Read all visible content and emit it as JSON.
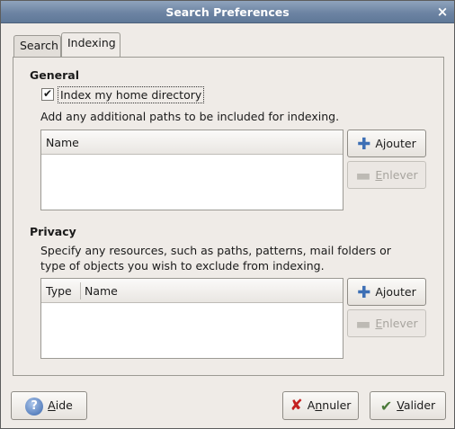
{
  "window": {
    "title": "Search Preferences",
    "close_label": "×"
  },
  "tabs": [
    {
      "label": "Search",
      "active": false
    },
    {
      "label": "Indexing",
      "active": true
    }
  ],
  "general": {
    "title": "General",
    "index_home_label": "Index my home directory",
    "index_home_checked": true,
    "paths_description": "Add any additional paths to be included for indexing.",
    "paths_list": {
      "columns": [
        "Name"
      ],
      "rows": []
    },
    "add_button": {
      "prefix": "A",
      "mnemonic": "j",
      "rest": "outer"
    },
    "remove_button": {
      "mnemonic": "E",
      "rest": "nlever",
      "disabled": true
    }
  },
  "privacy": {
    "title": "Privacy",
    "description_line1": "Specify any resources, such as paths, patterns, mail folders or",
    "description_line2": "type of objects you wish to exclude from indexing.",
    "exclude_list": {
      "columns": [
        "Type",
        "Name"
      ],
      "rows": []
    },
    "add_button": {
      "prefix": "A",
      "mnemonic": "j",
      "rest": "outer"
    },
    "remove_button": {
      "mnemonic": "E",
      "rest": "nlever",
      "disabled": true
    }
  },
  "footer": {
    "help": {
      "mnemonic": "A",
      "rest": "ide"
    },
    "cancel": {
      "prefix": "A",
      "mnemonic": "n",
      "rest": "nuler"
    },
    "ok": {
      "mnemonic": "V",
      "rest": "alider"
    }
  },
  "icons": {
    "help": "help-icon",
    "cancel": "cancel-icon",
    "ok": "validate-icon",
    "add": "plus-icon",
    "remove": "minus-icon"
  }
}
